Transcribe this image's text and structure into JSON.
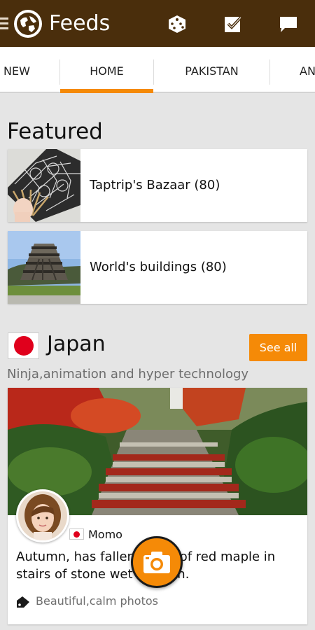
{
  "app": {
    "title": "Feeds"
  },
  "toolbar": {
    "actions": [
      "dice-icon",
      "checkbox-icon",
      "chat-icon"
    ]
  },
  "tabs": [
    {
      "label": "NEW",
      "selected": false
    },
    {
      "label": "HOME",
      "selected": true
    },
    {
      "label": "PAKISTAN",
      "selected": false
    },
    {
      "label": "AN",
      "selected": false
    }
  ],
  "featured": {
    "title": "Featured",
    "items": [
      {
        "label": "Taptrip's Bazaar (80)",
        "image": "folding-fan-photo"
      },
      {
        "label": "World's buildings (80)",
        "image": "geisel-library-photo"
      }
    ]
  },
  "section": {
    "title": "Japan",
    "subtitle": "Ninja,animation and hyper technology",
    "see_all": "See all",
    "flag": "japan-flag"
  },
  "post": {
    "author": "Momo",
    "caption": "Autumn, has fallen of red maple in stairs of stone wet n.",
    "caption_line1_a": "Autumn, has fallen",
    "caption_line1_b": "of red maple in",
    "caption_line2_a": "stairs of stone wet",
    "caption_line2_b": "n.",
    "tags": "Beautiful,calm photos",
    "image": "autumn-stone-stairs-photo"
  },
  "colors": {
    "appbar": "#4a2e0c",
    "accent": "#f58a07",
    "background": "#e5e5e5"
  }
}
